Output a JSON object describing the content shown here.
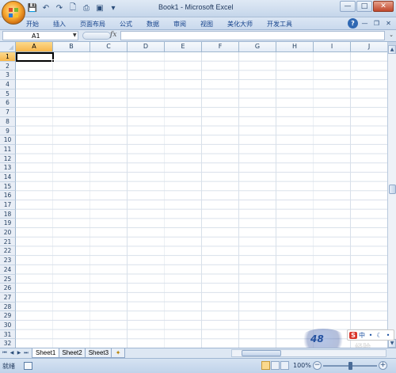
{
  "window": {
    "title": "Book1 - Microsoft Excel",
    "min": "—",
    "max": "□",
    "close": "✕"
  },
  "quick_access": [
    {
      "icon": "save-icon",
      "glyph": "💾"
    },
    {
      "icon": "undo-icon",
      "glyph": "↶"
    },
    {
      "icon": "redo-icon",
      "glyph": "↷"
    },
    {
      "icon": "new-icon",
      "glyph": "🗋"
    },
    {
      "icon": "print-icon",
      "glyph": "⎙"
    },
    {
      "icon": "preview-icon",
      "glyph": "▣"
    },
    {
      "icon": "customize-icon",
      "glyph": "▾"
    }
  ],
  "ribbon": {
    "tabs": [
      "开始",
      "插入",
      "页面布局",
      "公式",
      "数据",
      "审阅",
      "视图",
      "美化大师",
      "开发工具"
    ],
    "help": "?",
    "min": "—",
    "restore": "❐",
    "close": "✕"
  },
  "formula_bar": {
    "name_box": "A1",
    "fx": "fx",
    "value": ""
  },
  "grid": {
    "columns": [
      "A",
      "B",
      "C",
      "D",
      "E",
      "F",
      "G",
      "H",
      "I",
      "J"
    ],
    "rows": [
      "1",
      "2",
      "3",
      "4",
      "5",
      "6",
      "7",
      "8",
      "9",
      "10",
      "11",
      "12",
      "13",
      "14",
      "15",
      "16",
      "17",
      "18",
      "19",
      "20",
      "21",
      "22",
      "23",
      "24",
      "25",
      "26",
      "27",
      "28",
      "29",
      "30",
      "31",
      "32"
    ],
    "active_cell": "A1"
  },
  "sheets": {
    "nav": [
      "⏮",
      "◀",
      "▶",
      "⏭"
    ],
    "tabs": [
      "Sheet1",
      "Sheet2",
      "Sheet3"
    ],
    "active": "Sheet1",
    "add_glyph": "✦"
  },
  "status": {
    "ready": "就绪",
    "zoom": "100%",
    "minus": "−",
    "plus": "+",
    "zoom_fraction": 0.5
  },
  "ime": {
    "items": [
      "S",
      "中",
      "•",
      "☾",
      "•"
    ]
  },
  "watermark": {
    "text": "48",
    "text2": "经验"
  },
  "colors": {
    "selected_header": "#f7b64b",
    "ribbon_text": "#15428b",
    "gridline": "#d8e0ea"
  }
}
